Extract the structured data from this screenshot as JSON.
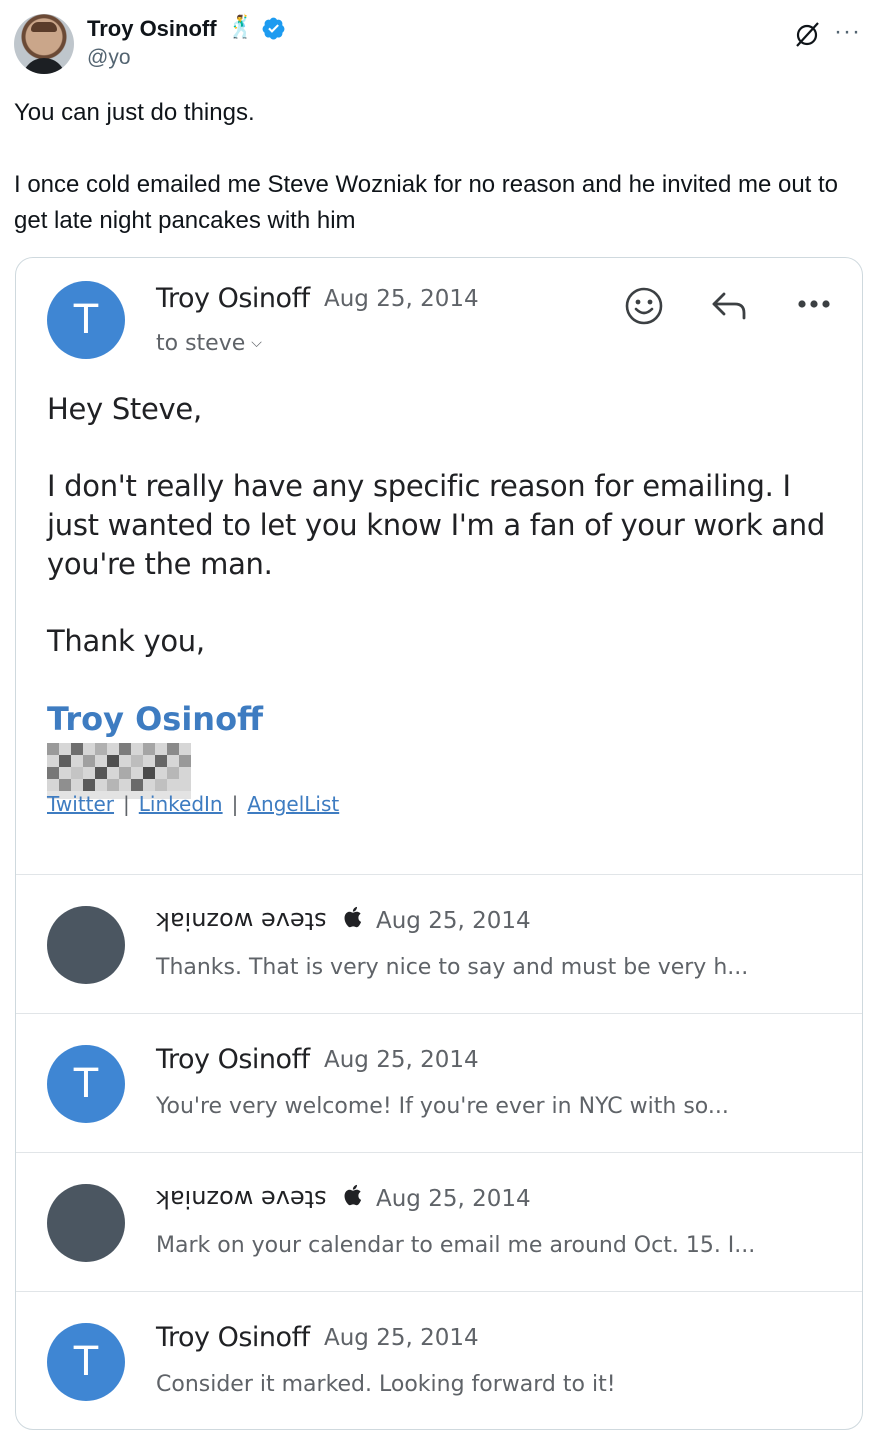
{
  "tweet": {
    "author_name": "Troy Osinoff",
    "author_emoji": "🕺",
    "handle": "@yo",
    "text_line1": "You can just do things.",
    "text_line2": "I once cold emailed me Steve Wozniak for no reason and he invited me out to get late night pancakes with him",
    "more_glyph": "···"
  },
  "email": {
    "avatar_letter": "T",
    "sender": "Troy Osinoff",
    "date": "Aug 25, 2014",
    "to": "to steve",
    "greeting": "Hey Steve,",
    "body": "I don't really have any specific reason for emailing. I just wanted to let you know I'm a fan of your work and you're the man.",
    "closing": "Thank you,",
    "signature_name": "Troy Osinoff",
    "links": [
      "Twitter",
      "LinkedIn",
      "AngelList"
    ]
  },
  "thread": [
    {
      "avatar_letter": "",
      "sender": "steve wozniak",
      "sender_flipped": true,
      "date": "Aug 25, 2014",
      "snippet": "Thanks. That is very nice to say and must be very h..."
    },
    {
      "avatar_letter": "T",
      "sender": "Troy Osinoff",
      "sender_flipped": false,
      "date": "Aug 25, 2014",
      "snippet": "You're very welcome! If you're ever in NYC with so..."
    },
    {
      "avatar_letter": "",
      "sender": "steve wozniak",
      "sender_flipped": true,
      "date": "Aug 25, 2014",
      "snippet": "Mark on your calendar to email me around Oct. 15. I..."
    },
    {
      "avatar_letter": "T",
      "sender": "Troy Osinoff",
      "sender_flipped": false,
      "date": "Aug 25, 2014",
      "snippet": "Consider it marked. Looking forward to it!"
    }
  ],
  "icons": {
    "verified": "verified-badge-icon",
    "grok": "grok-icon",
    "emoji_react": "smiley-icon",
    "reply": "reply-arrow-icon",
    "more": "more-dots-icon",
    "apple": "apple-logo-icon"
  },
  "colors": {
    "verified_blue": "#1d9bf0",
    "avatar_blue": "#3f86d3",
    "avatar_dark": "#4b5661",
    "link_blue": "#3e7cc1"
  }
}
